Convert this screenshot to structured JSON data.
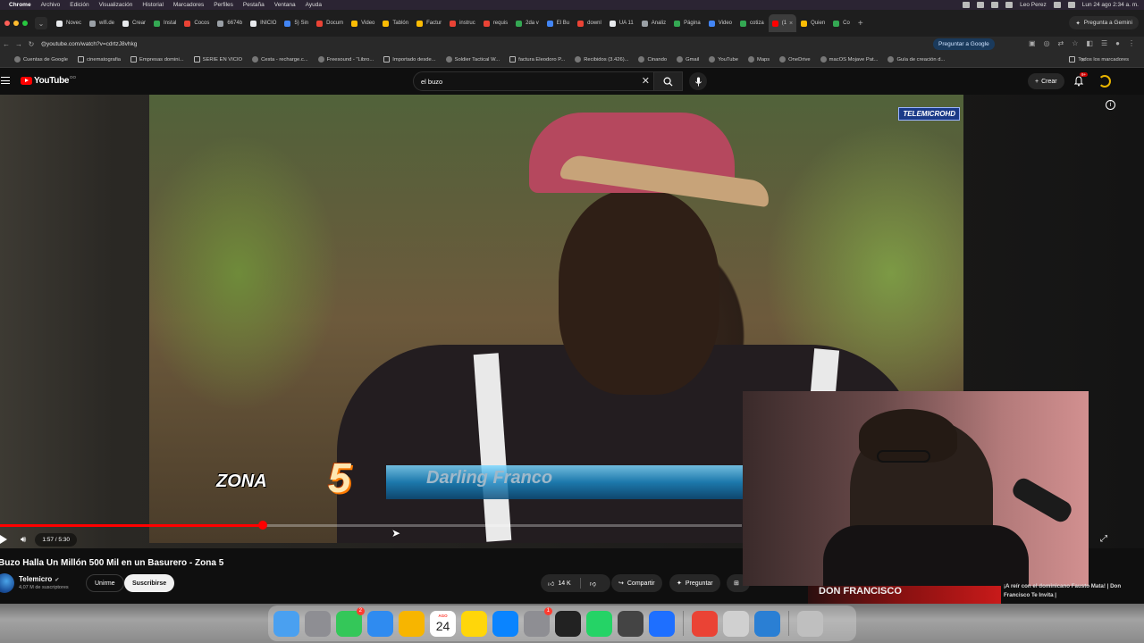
{
  "menubar": {
    "items": [
      "Chrome",
      "Archivo",
      "Edición",
      "Visualización",
      "Historial",
      "Marcadores",
      "Perfiles",
      "Pestaña",
      "Ventana",
      "Ayuda"
    ],
    "user": "Leo Perez",
    "datetime": "Lun 24 ago 2:34 a. m."
  },
  "tabs": [
    {
      "label": "Novec",
      "color": "#e8eaed"
    },
    {
      "label": "wifi.de",
      "color": "#9aa0a6"
    },
    {
      "label": "Crear",
      "color": "#e8eaed"
    },
    {
      "label": "Instal",
      "color": "#34a853"
    },
    {
      "label": "Cocos",
      "color": "#ea4335"
    },
    {
      "label": "6674b",
      "color": "#9aa0a6"
    },
    {
      "label": "INICIO",
      "color": "#e8eaed"
    },
    {
      "label": "5) Sin",
      "color": "#4285f4"
    },
    {
      "label": "Docum",
      "color": "#ea4335"
    },
    {
      "label": "Video",
      "color": "#fbbc04"
    },
    {
      "label": "Tablón",
      "color": "#fbbc04"
    },
    {
      "label": "Factur",
      "color": "#fbbc04"
    },
    {
      "label": "instruc",
      "color": "#ea4335"
    },
    {
      "label": "requis",
      "color": "#ea4335"
    },
    {
      "label": "2da v",
      "color": "#34a853"
    },
    {
      "label": "El Bu",
      "color": "#4285f4"
    },
    {
      "label": "downl",
      "color": "#ea4335"
    },
    {
      "label": "UA 11",
      "color": "#e8eaed"
    },
    {
      "label": "Analiz",
      "color": "#9aa0a6"
    },
    {
      "label": "Página",
      "color": "#34a853"
    },
    {
      "label": "Video",
      "color": "#4285f4"
    },
    {
      "label": "cotiza",
      "color": "#34a853"
    },
    {
      "label": "(1",
      "color": "#ff0000",
      "active": true
    },
    {
      "label": "Quien",
      "color": "#fbbc04"
    },
    {
      "label": "Co",
      "color": "#34a853"
    }
  ],
  "gemini_tab_button": "Pregunta a Gemini",
  "address": {
    "url": "youtube.com/watch?v=cdrtzJ8vhkg",
    "google_button": "Preguntar a Google"
  },
  "bookmarks": [
    {
      "label": "Cuentas de Google",
      "folder": false
    },
    {
      "label": "cinematografia",
      "folder": true
    },
    {
      "label": "Empresas domini...",
      "folder": true
    },
    {
      "label": "SERIE EN VICIO",
      "folder": true
    },
    {
      "label": "Cesta - recharge.c...",
      "folder": false
    },
    {
      "label": "Freesound - \"Libro...",
      "folder": false
    },
    {
      "label": "Importado desde...",
      "folder": true
    },
    {
      "label": "Soldier Tactical W...",
      "folder": false
    },
    {
      "label": "factura Eleodoro P...",
      "folder": true
    },
    {
      "label": "Recibidos (3.426)...",
      "folder": false
    },
    {
      "label": "Cinando",
      "folder": false
    },
    {
      "label": "Gmail",
      "folder": false
    },
    {
      "label": "YouTube",
      "folder": false
    },
    {
      "label": "Maps",
      "folder": false
    },
    {
      "label": "OneDrive",
      "folder": false
    },
    {
      "label": "macOS Mojave Pat...",
      "folder": false
    },
    {
      "label": "Guía de creación d...",
      "folder": false
    }
  ],
  "bookmarks_all": "Todos los marcadores",
  "youtube": {
    "logo_text": "YouTube",
    "logo_country": "DO",
    "search_value": "el buzo",
    "create_label": "Crear",
    "notifications_count": "9+"
  },
  "video": {
    "channel_bug": "TELEMICROHD",
    "lower_third_program": "ZONA",
    "lower_third_number": "5",
    "lower_third_name": "Darling Franco",
    "time_display": "1:57 / 5:30",
    "progress_fraction": 0.354
  },
  "meta": {
    "title": "Buzo Halla Un Millón 500 Mil en un Basurero - Zona 5",
    "channel": "Telemicro",
    "subscribers": "4,07 M de suscriptores",
    "join_label": "Unirme",
    "subscribe_label": "Suscribirse",
    "likes": "14 K",
    "share_label": "Compartir",
    "ask_label": "Preguntar"
  },
  "recommended": {
    "thumb_text": "DON FRANCISCO",
    "title": "¡A reír con el dominicano Fausto Mata! | Don Francisco Te Invita |"
  },
  "dock": {
    "calendar_month": "AGO",
    "calendar_day": "24",
    "messages_badge": "2",
    "settings_badge": "1",
    "apps": [
      {
        "name": "finder-icon",
        "color": "#4aa0f0"
      },
      {
        "name": "launchpad-icon",
        "color": "#8e8e93"
      },
      {
        "name": "messages-icon",
        "color": "#34c759"
      },
      {
        "name": "safari-icon",
        "color": "#2f8bf0"
      },
      {
        "name": "photos-icon",
        "color": "#f7b500"
      },
      {
        "name": "calendar-icon",
        "color": "#ffffff"
      },
      {
        "name": "notes-icon",
        "color": "#ffd60a"
      },
      {
        "name": "app-store-icon",
        "color": "#0a84ff"
      },
      {
        "name": "system-settings-icon",
        "color": "#8e8e93"
      },
      {
        "name": "davinci-resolve-icon",
        "color": "#222222"
      },
      {
        "name": "whatsapp-icon",
        "color": "#25d366"
      },
      {
        "name": "screen-recorder-icon",
        "color": "#444444"
      },
      {
        "name": "preview-icon",
        "color": "#1e6fff"
      },
      {
        "name": "chrome-icon",
        "color": "#ea4335"
      },
      {
        "name": "pencil-app-icon",
        "color": "#d0d0d0"
      },
      {
        "name": "proxy-app-icon",
        "color": "#2a7fd4"
      },
      {
        "name": "trash-icon",
        "color": "#bfbfbf"
      }
    ]
  }
}
